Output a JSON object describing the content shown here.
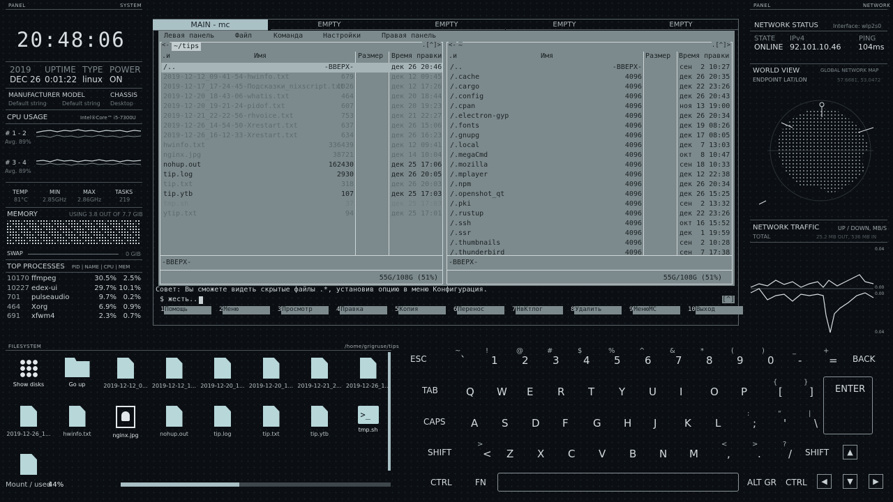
{
  "left_panel": {
    "header_panel": "PANEL",
    "header_system": "SYSTEM",
    "clock": "20:48:06",
    "date_labels": {
      "year": "2019",
      "uptime": "UPTIME",
      "type": "TYPE",
      "power": "POWER"
    },
    "date_values": {
      "date": "DEC 26",
      "uptime": "0:01:22",
      "type": "linux",
      "power": "ON"
    },
    "hw_labels": {
      "manufacturer": "MANUFACTURER",
      "model": "MODEL",
      "chassis": "CHASSIS"
    },
    "hw_values": {
      "manufacturer": "Default string",
      "model": "Default string",
      "chassis": "Desktop"
    },
    "cpu_title": "CPU USAGE",
    "cpu_model": "Intel®Core™ i5-7300U",
    "cpu_group1": "# 1 - 2",
    "cpu_group1_avg": "Avg. 89%",
    "cpu_group2": "# 3 - 4",
    "cpu_group2_avg": "Avg. 89%",
    "stats_labels": {
      "temp": "TEMP",
      "min": "MIN",
      "max": "MAX",
      "tasks": "TASKS"
    },
    "stats_values": {
      "temp": "81°C",
      "min": "2.85GHz",
      "max": "2.86GHz",
      "tasks": "219"
    },
    "memory_title": "MEMORY",
    "memory_usage": "USING 3.8 OUT OF 7.7 GIB",
    "swap_label": "SWAP",
    "swap_value": "0 GIB",
    "top_title": "TOP PROCESSES",
    "top_cols": "PID | NAME | CPU | MEM",
    "processes": [
      {
        "pid": "10170",
        "name": "ffmpeg",
        "cpu": "30.5%",
        "mem": "2.5%"
      },
      {
        "pid": "10227",
        "name": "edex-ui",
        "cpu": "29.7%",
        "mem": "10.1%"
      },
      {
        "pid": "701",
        "name": "pulseaudio",
        "cpu": "9.7%",
        "mem": "0.2%"
      },
      {
        "pid": "464",
        "name": "Xorg",
        "cpu": "6.9%",
        "mem": "0.9%"
      },
      {
        "pid": "691",
        "name": "xfwm4",
        "cpu": "2.3%",
        "mem": "0.7%"
      }
    ]
  },
  "tabs": [
    {
      "label": "MAIN - mc",
      "active": true
    },
    {
      "label": "EMPTY"
    },
    {
      "label": "EMPTY"
    },
    {
      "label": "EMPTY"
    },
    {
      "label": "EMPTY"
    }
  ],
  "mc": {
    "menu": [
      "Левая панель",
      "Файл",
      "Команда",
      "Настройки",
      "Правая панель"
    ],
    "left_path": "~/tips",
    "right_path": "~",
    "left_corner": "<- ",
    "right_corner": ".[^]>",
    "sort_indicator": ".и",
    "col_name": "Имя",
    "col_size": "Размер",
    "col_time": "Время правки",
    "left_files": [
      {
        "name": "/..",
        "size": "-ВВЕРХ-",
        "time": "дек 26 20:46",
        "style": "cur"
      },
      {
        "name": "2019-12-12_09-41-54-hwinfo.txt",
        "size": "679",
        "time": "дек 12 09:45",
        "style": "dim"
      },
      {
        "name": "2019-12-17_17-24-45-Подсказки_nixscript.txt",
        "size": "1026",
        "time": "дек 12 17:26",
        "style": "dim"
      },
      {
        "name": "2019-12-20_18-43-06-whatis.txt",
        "size": "464",
        "time": "дек 20 18:44",
        "style": "dim"
      },
      {
        "name": "2019-12-20_19-21-24-pidof.txt",
        "size": "607",
        "time": "дек 20 19:23",
        "style": "dim"
      },
      {
        "name": "2019-12-21_22-22-56-rhvoice.txt",
        "size": "753",
        "time": "дек 21 22:27",
        "style": "dim"
      },
      {
        "name": "2019-12-26_14-54-50-Xrestart.txt",
        "size": "637",
        "time": "дек 26 15:06",
        "style": "dim"
      },
      {
        "name": "2019-12-26_16-12-33-Xrestart.txt",
        "size": "634",
        "time": "дек 26 16:23",
        "style": "dim"
      },
      {
        "name": "hwinfo.txt",
        "size": "336439",
        "time": "дек 12 09:41",
        "style": "dim"
      },
      {
        "name": "nginx.jpg",
        "size": "38721",
        "time": "дек 14 10:04",
        "style": "dim"
      },
      {
        "name": "nohup.out",
        "size": "162430",
        "time": "дек 25 17:06",
        "style": "normal"
      },
      {
        "name": "tip.log",
        "size": "2930",
        "time": "дек 26 20:05",
        "style": "normal"
      },
      {
        "name": "tip.txt",
        "size": "318",
        "time": "дек 26 20:03",
        "style": "dim"
      },
      {
        "name": "tip.ytb",
        "size": "107",
        "time": "дек 25 17:03",
        "style": "normal"
      },
      {
        "name": "tmp.sh",
        "size": "37",
        "time": "дек 25 17:03",
        "style": "faint"
      },
      {
        "name": "ytip.txt",
        "size": "94",
        "time": "дек 25 17:01",
        "style": "dim"
      }
    ],
    "right_files": [
      {
        "name": "/..",
        "size": "-ВВЕРХ-",
        "time": "сен  2 10:27"
      },
      {
        "name": "/.cache",
        "size": "4096",
        "time": "дек 26 20:35"
      },
      {
        "name": "/.cargo",
        "size": "4096",
        "time": "дек 22 23:26"
      },
      {
        "name": "/.config",
        "size": "4096",
        "time": "дек 26 20:43"
      },
      {
        "name": "/.cpan",
        "size": "4096",
        "time": "ноя 13 19:00"
      },
      {
        "name": "/.electron-gyp",
        "size": "4096",
        "time": "дек 26 20:34"
      },
      {
        "name": "/.fonts",
        "size": "4096",
        "time": "дек 19 08:26"
      },
      {
        "name": "/.gnupg",
        "size": "4096",
        "time": "дек 17 08:05"
      },
      {
        "name": "/.local",
        "size": "4096",
        "time": "дек  7 13:03"
      },
      {
        "name": "/.megaCmd",
        "size": "4096",
        "time": "окт  8 10:47"
      },
      {
        "name": "/.mozilla",
        "size": "4096",
        "time": "сен 18 10:33"
      },
      {
        "name": "/.mplayer",
        "size": "4096",
        "time": "дек 12 22:38"
      },
      {
        "name": "/.npm",
        "size": "4096",
        "time": "дек 26 20:34"
      },
      {
        "name": "/.openshot_qt",
        "size": "4096",
        "time": "дек 26 15:25"
      },
      {
        "name": "/.pki",
        "size": "4096",
        "time": "сен  2 13:32"
      },
      {
        "name": "/.rustup",
        "size": "4096",
        "time": "дек 22 23:26"
      },
      {
        "name": "/.ssh",
        "size": "4096",
        "time": "окт 16 15:52"
      },
      {
        "name": "/.ssr",
        "size": "4096",
        "time": "дек  1 19:59"
      },
      {
        "name": "/.thumbnails",
        "size": "4096",
        "time": "сен  2 10:28"
      },
      {
        "name": "/.thunderbird",
        "size": "4096",
        "time": "сен  7 17:38"
      }
    ],
    "left_status": "-ВВЕРХ-",
    "right_status": "-ВВЕРХ-",
    "left_disk": "55G/108G (51%)",
    "right_disk": "55G/108G (51%)",
    "hint": "Совет: Вы сможете видеть скрытые файлы .*, установив опцию в меню Конфигурация.",
    "prompt": "$ жесть...",
    "prompt_corner": "[^]",
    "fkeys": [
      {
        "num": "1",
        "label": "Помощь"
      },
      {
        "num": "2",
        "label": "Меню"
      },
      {
        "num": "3",
        "label": "Просмотр"
      },
      {
        "num": "4",
        "label": "Правка"
      },
      {
        "num": "5",
        "label": "Копия"
      },
      {
        "num": "6",
        "label": "Перенос"
      },
      {
        "num": "7",
        "label": "НвКтлог"
      },
      {
        "num": "8",
        "label": "Удалить"
      },
      {
        "num": "9",
        "label": "МенюMC"
      },
      {
        "num": "10",
        "label": "Выход"
      }
    ]
  },
  "filesystem": {
    "title": "FILESYSTEM",
    "path": "/home/grigruse/tips",
    "items": [
      {
        "label": "Show disks",
        "icon": "grid-icon"
      },
      {
        "label": "Go up",
        "icon": "folder-icon"
      },
      {
        "label": "2019-12-12_0...",
        "icon": "file-icon"
      },
      {
        "label": "2019-12-12_1...",
        "icon": "file-icon"
      },
      {
        "label": "2019-12-20_1...",
        "icon": "file-icon"
      },
      {
        "label": "2019-12-20_1...",
        "icon": "file-icon"
      },
      {
        "label": "2019-12-21_2...",
        "icon": "file-icon"
      },
      {
        "label": "2019-12-26_1...",
        "icon": "file-icon"
      },
      {
        "label": "2019-12-26_1...",
        "icon": "file-icon"
      },
      {
        "label": "hwinfo.txt",
        "icon": "file-icon"
      },
      {
        "label": "nginx.jpg",
        "icon": "image-icon"
      },
      {
        "label": "nohup.out",
        "icon": "file-icon"
      },
      {
        "label": "tip.log",
        "icon": "file-icon"
      },
      {
        "label": "tip.txt",
        "icon": "file-icon"
      },
      {
        "label": "tip.ytb",
        "icon": "file-icon"
      },
      {
        "label": "tmp.sh",
        "icon": "terminal-icon"
      },
      {
        "label": "",
        "icon": "file-icon"
      }
    ],
    "mount": "Mount / used",
    "mount_pct": "44%",
    "usage_fraction": 0.44
  },
  "keyboard": {
    "row1": [
      {
        "main": "ESC"
      },
      {
        "main": "`",
        "alt": "~"
      },
      {
        "main": "1",
        "alt": "!"
      },
      {
        "main": "2",
        "alt": "@"
      },
      {
        "main": "3",
        "alt": "#"
      },
      {
        "main": "4",
        "alt": "$"
      },
      {
        "main": "5",
        "alt": "%"
      },
      {
        "main": "6",
        "alt": "^"
      },
      {
        "main": "7",
        "alt": "&"
      },
      {
        "main": "8",
        "alt": "*"
      },
      {
        "main": "9",
        "alt": "("
      },
      {
        "main": "0",
        "alt": ")"
      },
      {
        "main": "-",
        "alt": "_"
      },
      {
        "main": "=",
        "alt": "+"
      },
      {
        "main": "BACK"
      }
    ],
    "row2": [
      {
        "main": "TAB"
      },
      {
        "main": "Q"
      },
      {
        "main": "W"
      },
      {
        "main": "E"
      },
      {
        "main": "R"
      },
      {
        "main": "T"
      },
      {
        "main": "Y"
      },
      {
        "main": "U"
      },
      {
        "main": "I"
      },
      {
        "main": "O"
      },
      {
        "main": "P"
      },
      {
        "main": "[",
        "alt": "{"
      },
      {
        "main": "]",
        "alt": "}"
      }
    ],
    "row3": [
      {
        "main": "CAPS"
      },
      {
        "main": "A"
      },
      {
        "main": "S"
      },
      {
        "main": "D"
      },
      {
        "main": "F"
      },
      {
        "main": "G"
      },
      {
        "main": "H"
      },
      {
        "main": "J"
      },
      {
        "main": "K"
      },
      {
        "main": "L"
      },
      {
        "main": ";",
        "alt": ":"
      },
      {
        "main": "'",
        "alt": "\""
      },
      {
        "main": "\\",
        "alt": "|"
      }
    ],
    "row4": [
      {
        "main": "SHIFT"
      },
      {
        "main": "<",
        "alt": ">"
      },
      {
        "main": "Z"
      },
      {
        "main": "X"
      },
      {
        "main": "C"
      },
      {
        "main": "V"
      },
      {
        "main": "B"
      },
      {
        "main": "N"
      },
      {
        "main": "M"
      },
      {
        "main": ",",
        "alt": "<"
      },
      {
        "main": ".",
        "alt": ">"
      },
      {
        "main": "/",
        "alt": "?"
      },
      {
        "main": "SHIFT"
      }
    ],
    "enter": "ENTER",
    "ctrl": "CTRL",
    "fn": "FN",
    "altgr": "ALT GR",
    "ctrl_right": "CTRL"
  },
  "right_panel": {
    "header_panel": "PANEL",
    "header_network": "NETWORK",
    "status_title": "NETWORK STATUS",
    "interface": "Interface: wlp2s0",
    "state_label": "STATE",
    "ipv4_label": "IPv4",
    "ping_label": "PING",
    "state_value": "ONLINE",
    "ipv4_value": "92.101.10.46",
    "ping_value": "104ms",
    "world_title": "WORLD VIEW",
    "world_sub": "GLOBAL NETWORK MAP",
    "endpoint_label": "ENDPOINT LAT/LON",
    "endpoint_value": "57.6681, 53.0472",
    "traffic_title": "NETWORK TRAFFIC",
    "traffic_sub": "UP / DOWN, MB/S",
    "total_label": "TOTAL",
    "total_value": "25.2 MB OUT, 536 MB IN",
    "scale_top": "0.04",
    "scale_mid1": "0.00",
    "scale_mid2": "0.00",
    "scale_bottom": "0.04"
  },
  "colors": {
    "accent": "#a9c0c5",
    "mc_bg": "#7d8a8d",
    "icon": "#b7d7d9",
    "bg": "#0b0f13"
  }
}
